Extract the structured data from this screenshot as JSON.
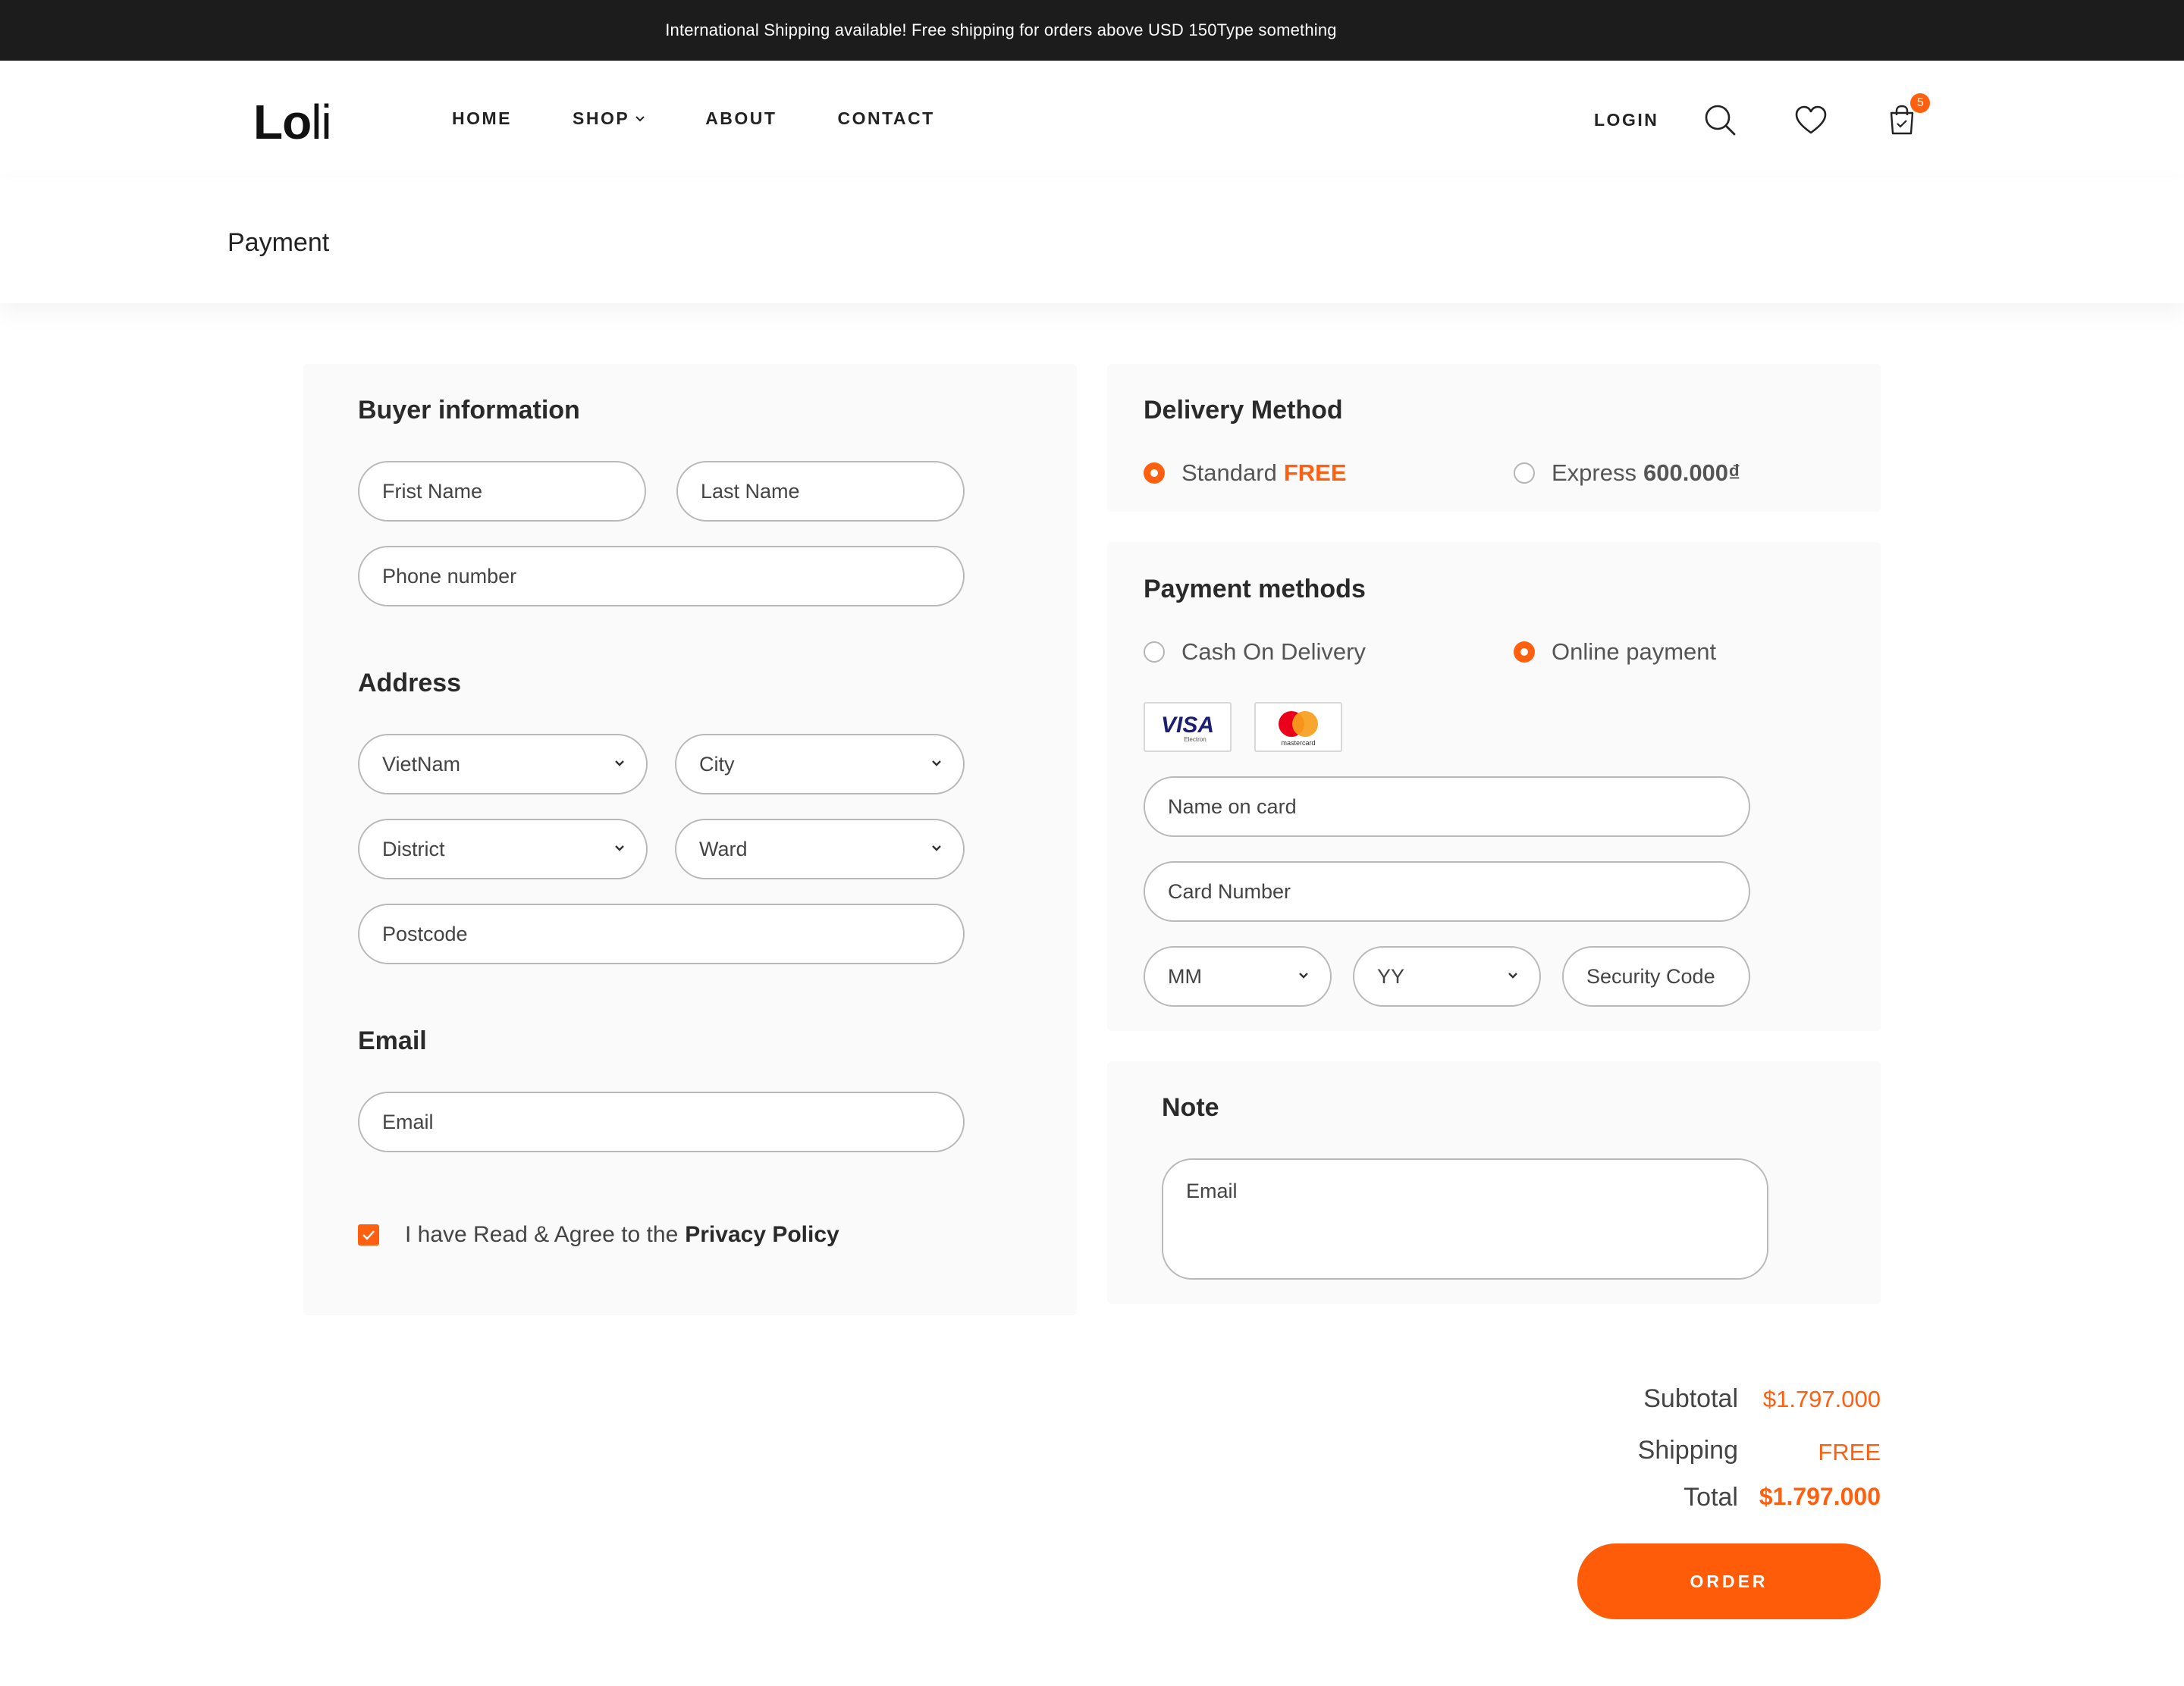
{
  "announcement": "International Shipping available! Free shipping for orders above USD 150Type something",
  "logo": {
    "bold": "Lo",
    "light": "li"
  },
  "nav": {
    "home": "HOME",
    "shop": "SHOP",
    "about": "ABOUT",
    "contact": "CONTACT"
  },
  "header": {
    "login": "LOGIN",
    "cart_count": "5"
  },
  "page_title": "Payment",
  "buyer": {
    "heading": "Buyer information",
    "first_name_placeholder": "Frist Name",
    "last_name_placeholder": "Last Name",
    "phone_placeholder": "Phone number"
  },
  "address": {
    "heading": "Address",
    "country_value": "VietNam",
    "city_placeholder": "City",
    "district_placeholder": "District",
    "ward_placeholder": "Ward",
    "postcode_placeholder": "Postcode"
  },
  "email_section": {
    "heading": "Email",
    "email_placeholder": "Email"
  },
  "agree": {
    "text": "I have Read & Agree to the",
    "link": "Privacy Policy",
    "checked": true
  },
  "delivery": {
    "heading": "Delivery Method",
    "standard_label": "Standard",
    "standard_price": "FREE",
    "express_label": "Express",
    "express_price": "600.000₫",
    "selected": "standard"
  },
  "payment": {
    "heading": "Payment methods",
    "cod_label": "Cash On Delivery",
    "online_label": "Online payment",
    "selected": "online",
    "visa_text": "VISA",
    "visa_sub": "Electron",
    "mastercard_text": "mastercard",
    "name_placeholder": "Name on card",
    "card_number_placeholder": "Card Number",
    "month_placeholder": "MM",
    "year_placeholder": "YY",
    "security_placeholder": "Security Code"
  },
  "note": {
    "heading": "Note",
    "placeholder": "Email"
  },
  "totals": {
    "subtotal_label": "Subtotal",
    "subtotal_value": "$1.797.000",
    "shipping_label": "Shipping",
    "shipping_value": "FREE",
    "total_label": "Total",
    "total_value": "$1.797.000"
  },
  "order_button": "ORDER",
  "colors": {
    "accent": "#ff6010",
    "topbar": "#1c1c1c",
    "panel": "#fafafa"
  }
}
